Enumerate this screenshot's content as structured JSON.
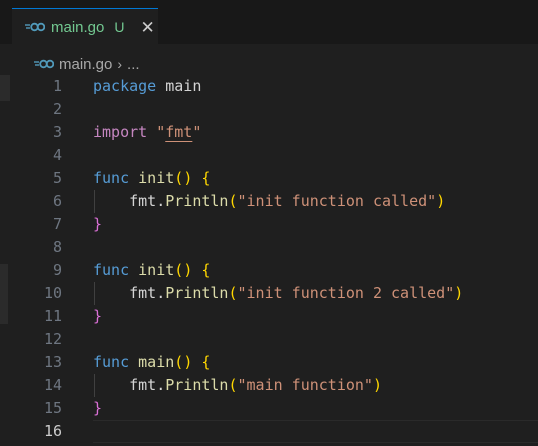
{
  "tab": {
    "file_name": "main.go",
    "status": "U",
    "close_glyph": "✕",
    "icon": "go-icon"
  },
  "breadcrumb": {
    "file_name": "main.go",
    "separator": "›",
    "more": "..."
  },
  "editor": {
    "current_line": 16,
    "lines": [
      {
        "n": "1",
        "text": "package main"
      },
      {
        "n": "2",
        "text": ""
      },
      {
        "n": "3",
        "text": "import \"fmt\""
      },
      {
        "n": "4",
        "text": ""
      },
      {
        "n": "5",
        "text": "func init() {"
      },
      {
        "n": "6",
        "text": "    fmt.Println(\"init function called\")"
      },
      {
        "n": "7",
        "text": "}"
      },
      {
        "n": "8",
        "text": ""
      },
      {
        "n": "9",
        "text": "func init() {"
      },
      {
        "n": "10",
        "text": "    fmt.Println(\"init function 2 called\")"
      },
      {
        "n": "11",
        "text": "}"
      },
      {
        "n": "12",
        "text": ""
      },
      {
        "n": "13",
        "text": "func main() {"
      },
      {
        "n": "14",
        "text": "    fmt.Println(\"main function\")"
      },
      {
        "n": "15",
        "text": "}"
      },
      {
        "n": "16",
        "text": ""
      }
    ]
  },
  "colors": {
    "keyword": "#569cd6",
    "keyword_control": "#c586c0",
    "function": "#dcdcaa",
    "string": "#ce9178",
    "bracket_level1": "#ffd700",
    "bracket_level2": "#da70d6",
    "modified": "#73c991"
  }
}
